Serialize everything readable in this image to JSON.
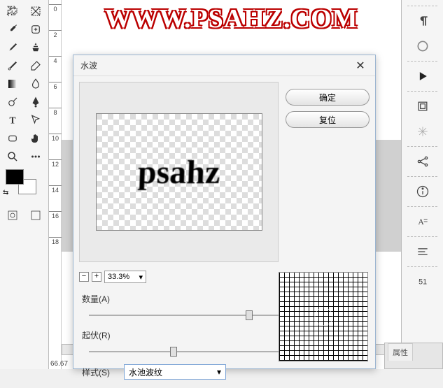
{
  "canvas": {
    "logo": "WWW.PSAHZ.COM",
    "zoom_indicator": "66.67",
    "ruler_ticks": [
      "0",
      "2",
      "4",
      "6",
      "8",
      "10",
      "12",
      "14",
      "16",
      "18"
    ]
  },
  "dialog": {
    "title": "水波",
    "ok_label": "确定",
    "reset_label": "复位",
    "preview_text": "psahz",
    "zoom_pct": "33.3%",
    "amount_label": "数量(A)",
    "amount_value": "20",
    "ridge_label": "起伏(R)",
    "ridge_value": "6",
    "style_label": "样式(S)",
    "style_value": "水池波纹"
  },
  "panels": {
    "properties_tab": "属性"
  }
}
